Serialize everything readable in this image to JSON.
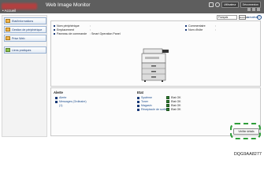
{
  "titlebar": {
    "brand_logo": "blurred-brand-logo",
    "app_title": "Web Image Monitor",
    "user_label": "Utilisateur",
    "logout_label": "Déconnexion"
  },
  "breadcrumb": {
    "home": "• Accueil"
  },
  "sidebar": {
    "items": [
      {
        "label": "Etat/Informations",
        "icon": "folder-icon"
      },
      {
        "label": "Gestion de périphérique",
        "icon": "folder-icon"
      },
      {
        "label": "Prise Web",
        "icon": "folder-icon"
      },
      {
        "label": "Liens pratiques",
        "icon": "link-icon"
      }
    ]
  },
  "toolbar": {
    "language_value": "Français",
    "go_label": "Exécuter",
    "refresh_label": "Actualiser",
    "help_label": "?"
  },
  "device": {
    "fields_left": [
      {
        "label": "Nom périphérique",
        "value": ":"
      },
      {
        "label": "Emplacement",
        "value": ":"
      },
      {
        "label": "Panneau de commande",
        "value": ": Smart Operation Panel"
      }
    ],
    "fields_right": [
      {
        "label": "Commentaire",
        "value": ":"
      },
      {
        "label": "Nom d'hôte",
        "value": ":"
      }
    ]
  },
  "alerts": {
    "heading": "Alerte",
    "items": [
      {
        "label": "Alerte"
      },
      {
        "label": "Messages (Ordinaire)",
        "count": "(1)"
      }
    ],
    "button_label": "Vérifier détails"
  },
  "status": {
    "heading": "Etat",
    "rows": [
      {
        "label": "Système",
        "state": "Etat OK"
      },
      {
        "label": "Toner",
        "state": "Etat OK"
      },
      {
        "label": "Magasin",
        "state": "Etat OK"
      },
      {
        "label": "Réceptacle de sortie",
        "state": "Etat OK"
      }
    ]
  },
  "image_code": "DQG9AA8277",
  "colors": {
    "titlebar": "#5e5e5e",
    "highlight": "#2f9e3a",
    "status_ok": "#2f7d32",
    "link": "#1a4b8c"
  }
}
